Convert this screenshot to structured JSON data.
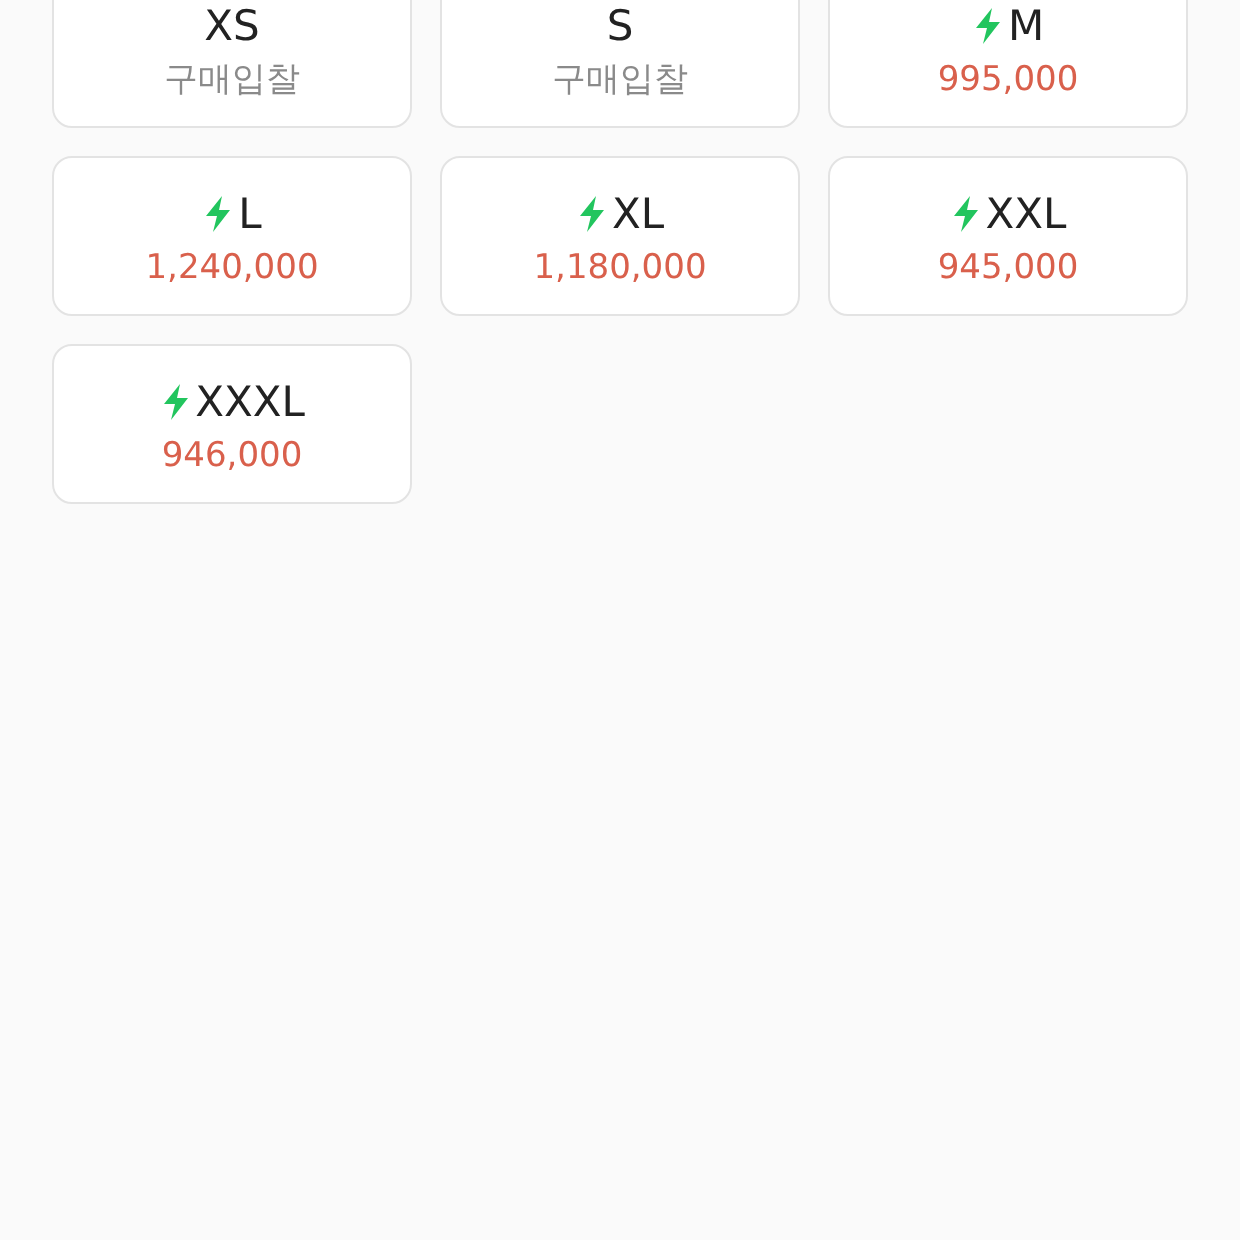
{
  "sizes": [
    {
      "size": "XS",
      "price": "구매입찰",
      "fast": false
    },
    {
      "size": "S",
      "price": "구매입찰",
      "fast": false
    },
    {
      "size": "M",
      "price": "995,000",
      "fast": true
    },
    {
      "size": "L",
      "price": "1,240,000",
      "fast": true
    },
    {
      "size": "XL",
      "price": "1,180,000",
      "fast": true
    },
    {
      "size": "XXL",
      "price": "945,000",
      "fast": true
    },
    {
      "size": "XXXL",
      "price": "946,000",
      "fast": true
    }
  ]
}
